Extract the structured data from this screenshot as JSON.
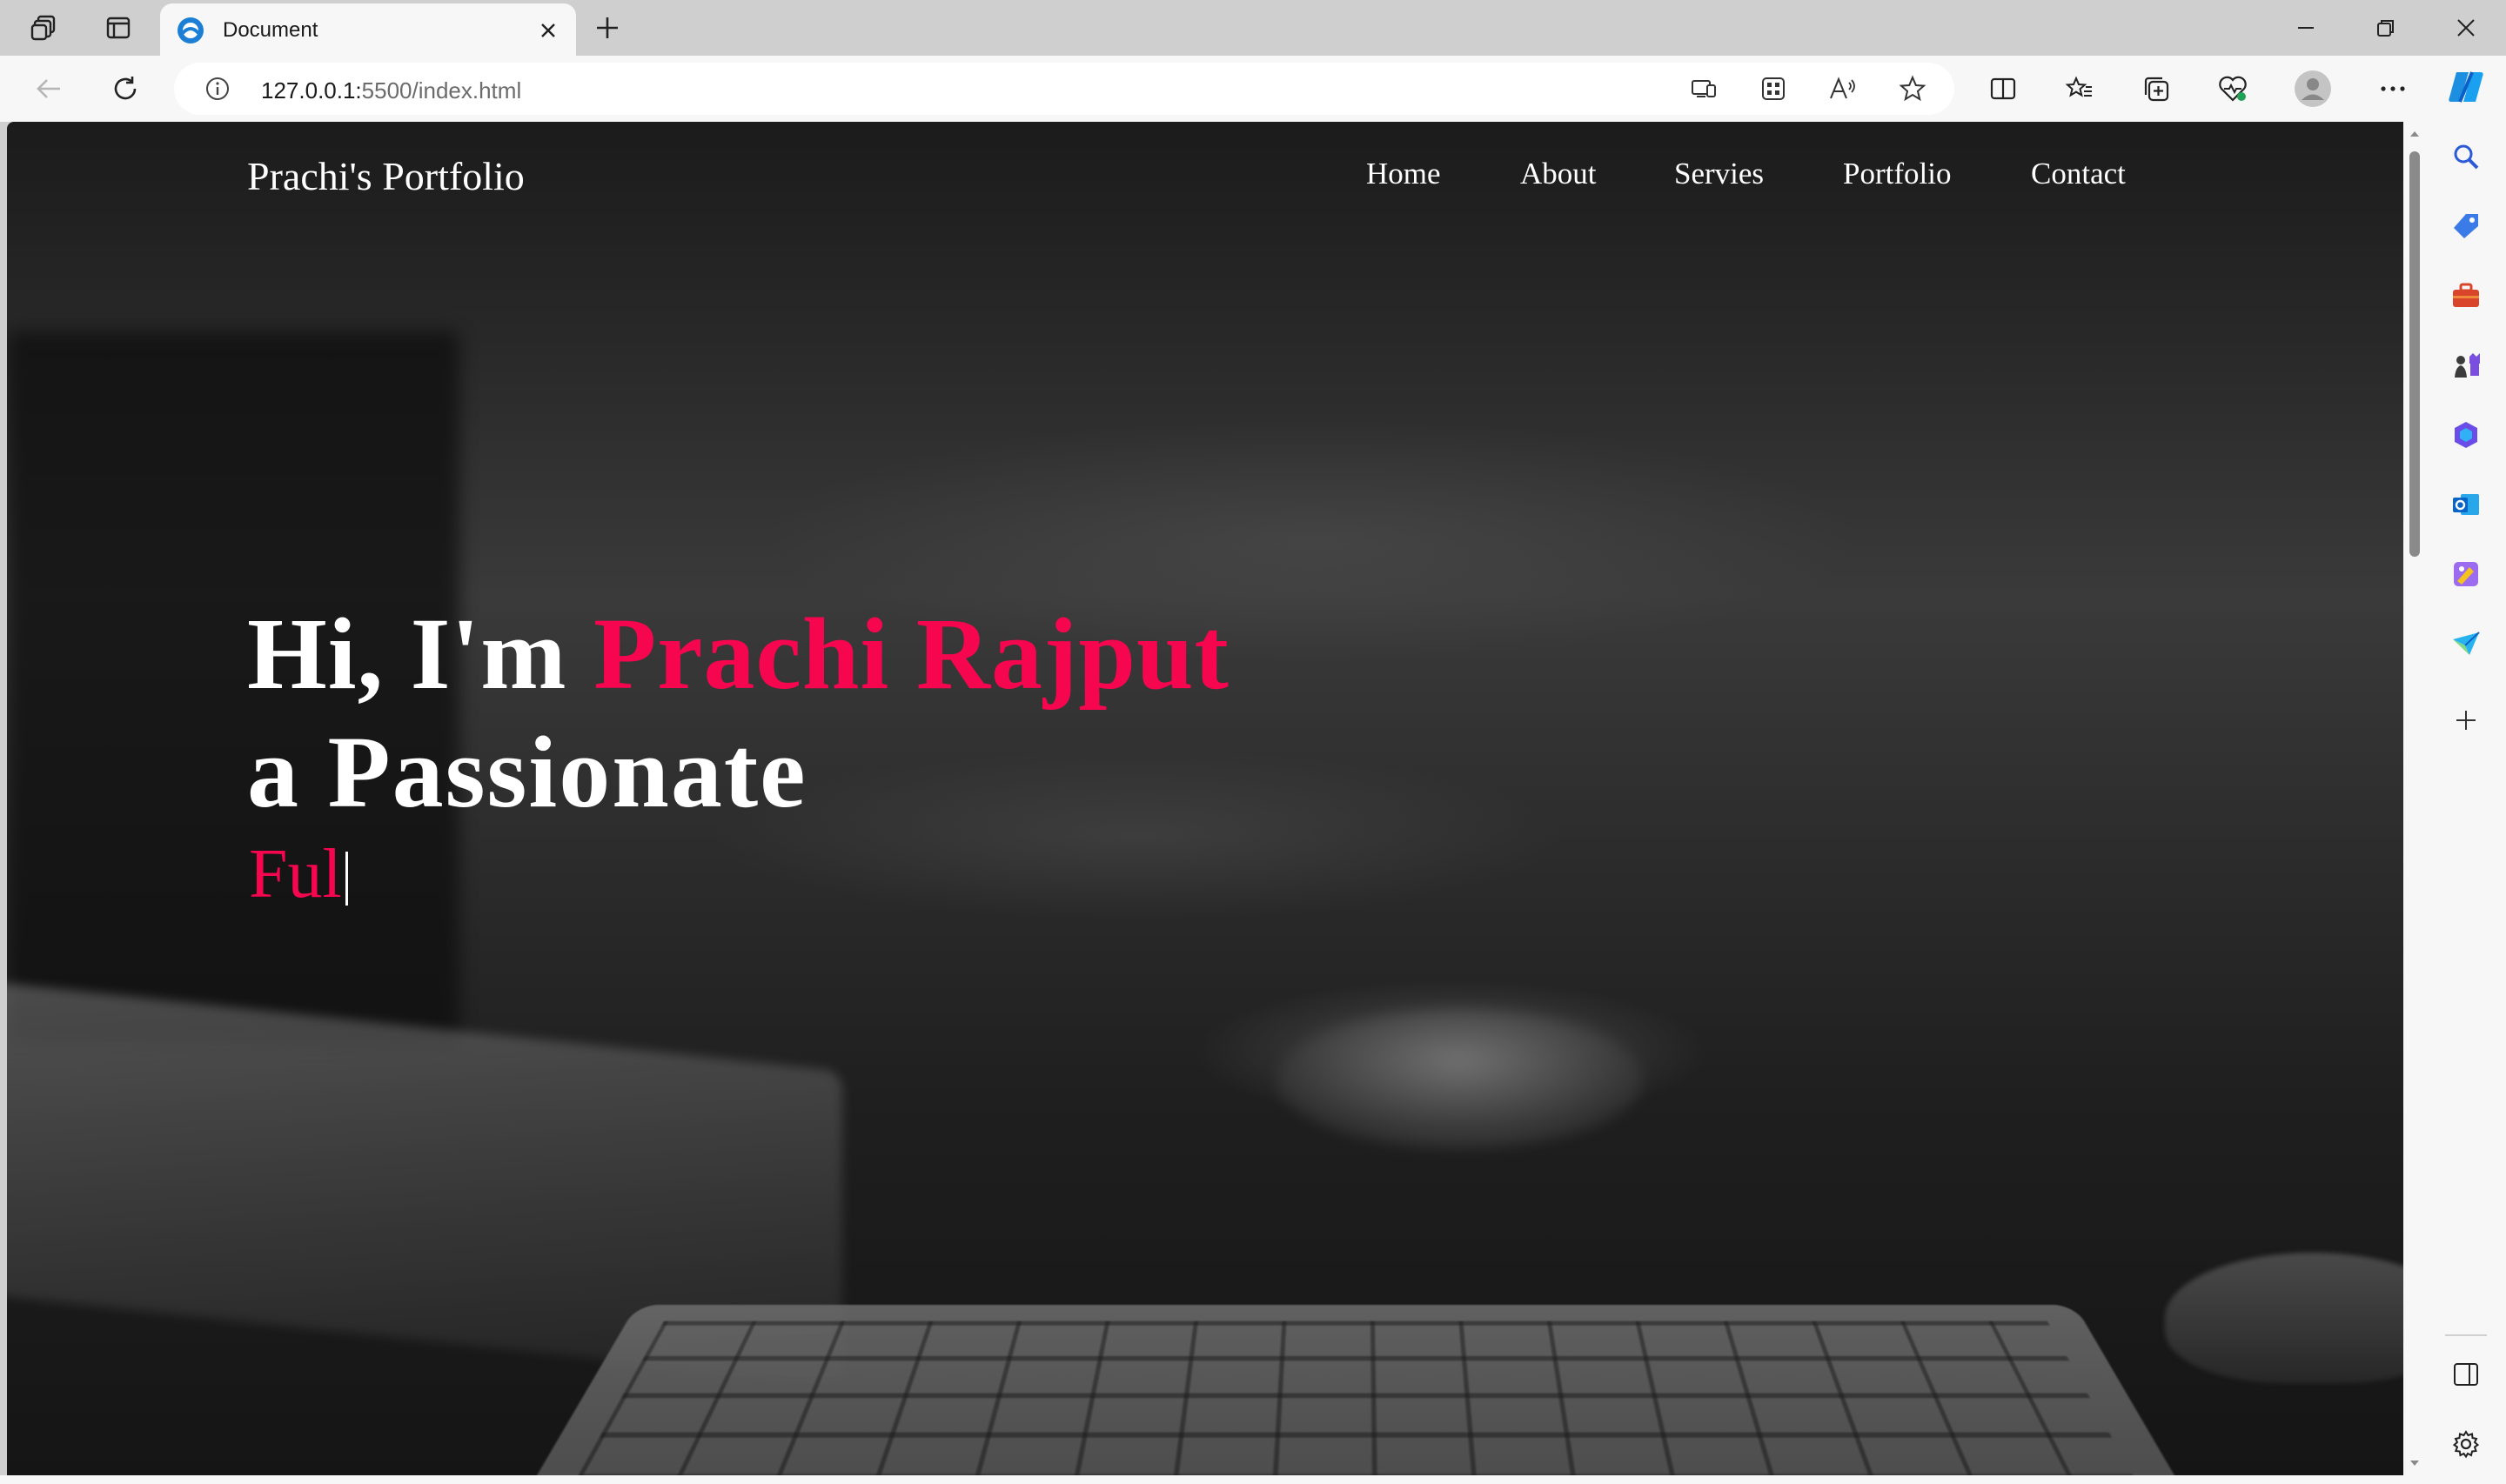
{
  "browser": {
    "tab": {
      "title": "Document"
    },
    "url": {
      "host": "127.0.0.1:",
      "rest": "5500/index.html"
    }
  },
  "site": {
    "logo": "Prachi's Portfolio",
    "nav": [
      "Home",
      "About",
      "Servies",
      "Portfolio",
      "Contact"
    ],
    "hero": {
      "greeting": "Hi, I'm ",
      "name": "Prachi Rajput",
      "line2": "a Passionate",
      "typed": "Ful"
    }
  },
  "colors": {
    "accent": "#f5064e",
    "text": "#ffffff",
    "chrome": "#f7f7f7"
  }
}
